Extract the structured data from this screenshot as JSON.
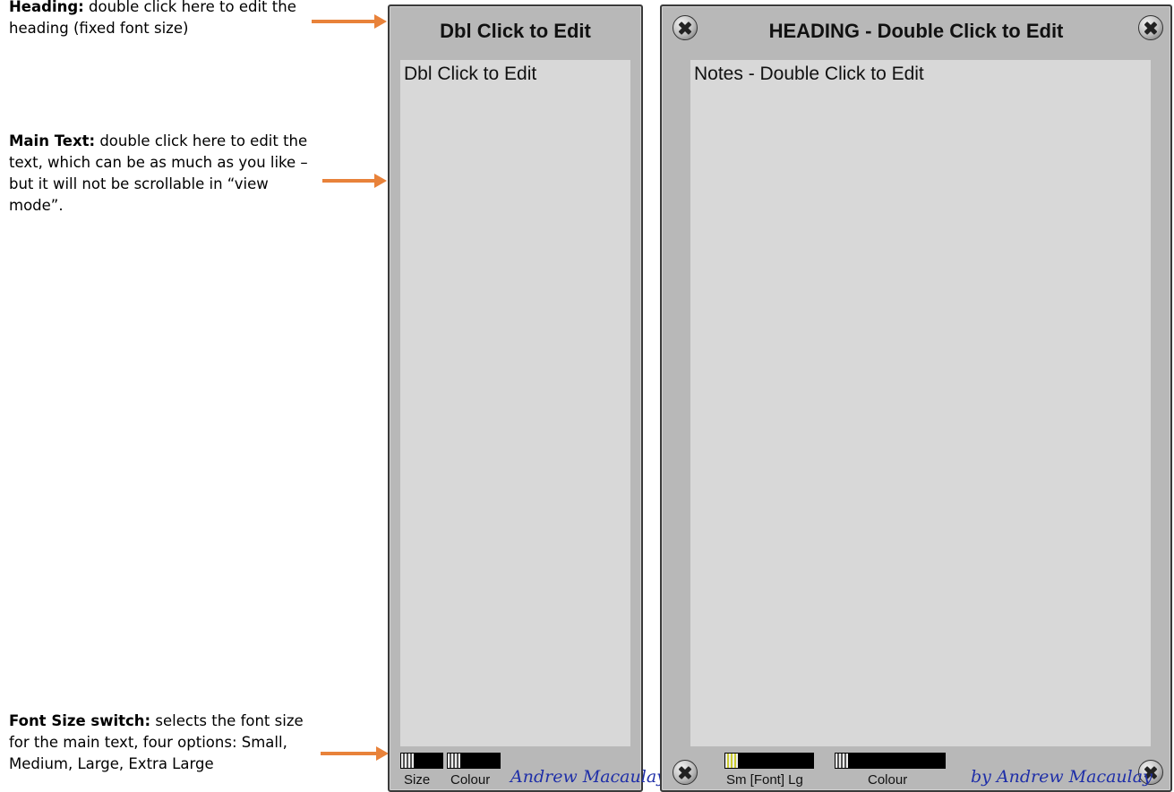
{
  "annotations": {
    "heading": {
      "title": "Heading:",
      "text": " double click here to edit the heading (fixed font size)"
    },
    "main_text": {
      "title": "Main Text:",
      "text": " double click here to edit the text, which can be as much as you like – but it will not be scrollable in “view mode”."
    },
    "font_size": {
      "title": "Font Size switch:",
      "text": " selects the font size for the main text, four options: Small, Medium, Large, Extra Large"
    }
  },
  "panel_small": {
    "heading": "Dbl Click to Edit",
    "notes": "Dbl Click to Edit",
    "size_label": "Size",
    "colour_label": "Colour",
    "signature": "Andrew Macaulay"
  },
  "panel_large": {
    "heading": "HEADING - Double Click to Edit",
    "notes": "Notes - Double Click to Edit",
    "font_label": "Sm [Font] Lg",
    "colour_label": "Colour",
    "signature": "by Andrew Macaulay"
  },
  "colors": {
    "arrow": "#e8823a",
    "panel_bg": "#b8b8b8",
    "notes_bg": "#d8d8d8",
    "signature": "#1f2fa8"
  }
}
